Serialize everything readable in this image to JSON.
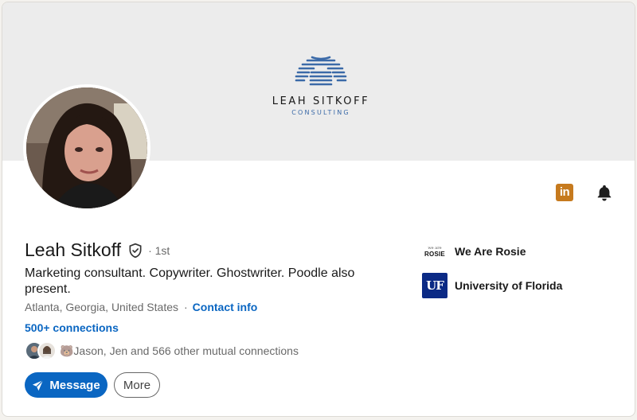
{
  "banner": {
    "brand_name": "LEAH SITKOFF",
    "brand_sub": "CONSULTING",
    "brand_color": "#3b6aa8"
  },
  "profile": {
    "name": "Leah Sitkoff",
    "degree": "· 1st",
    "headline": "Marketing consultant. Copywriter. Ghostwriter. Poodle also present.",
    "location": "Atlanta, Georgia, United States",
    "separator": "·",
    "contact_info_label": "Contact info",
    "connections_label": "500+ connections",
    "mutual_text": "🐻Jason, Jen and 566 other mutual connections"
  },
  "icons": {
    "verified": "shield-check-icon",
    "linkedin": "linkedin-icon",
    "bell": "bell-icon",
    "send": "paper-plane-icon"
  },
  "actions": {
    "message_label": "Message",
    "more_label": "More"
  },
  "experience": [
    {
      "logo_top": "we are",
      "logo_word": "ROSIE",
      "name": "We Are Rosie"
    },
    {
      "logo_text": "UF",
      "name": "University of Florida"
    }
  ],
  "colors": {
    "accent": "#0a66c2",
    "linkedin_badge": "#c67a1e",
    "uf_blue": "#0b2a85"
  }
}
